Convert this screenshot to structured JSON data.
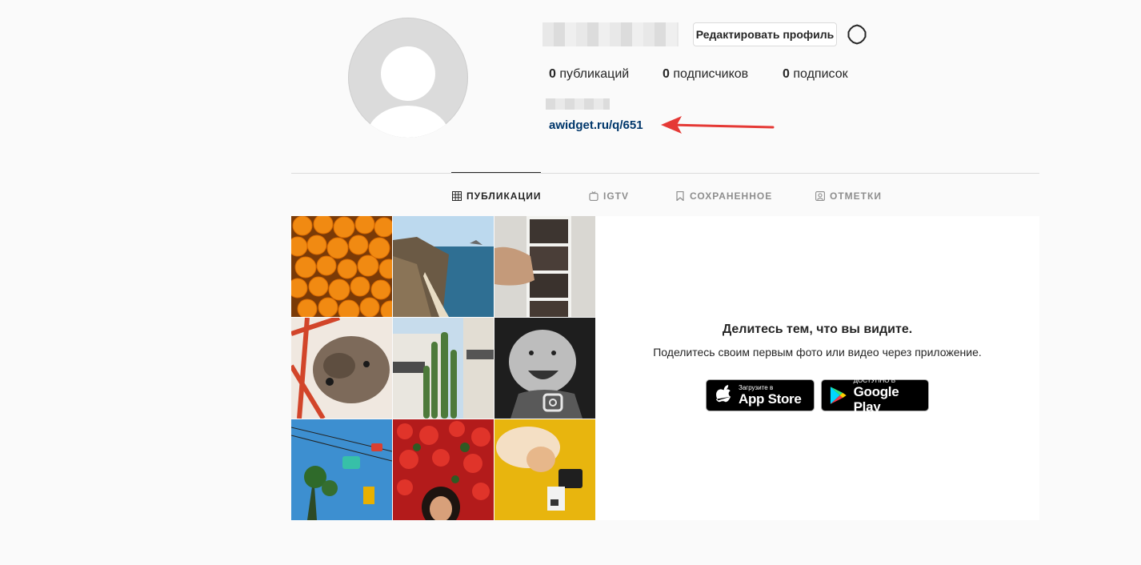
{
  "profile": {
    "edit_button": "Редактировать профиль",
    "stats": [
      {
        "count": "0",
        "label": "публикаций"
      },
      {
        "count": "0",
        "label": "подписчиков"
      },
      {
        "count": "0",
        "label": "подписок"
      }
    ],
    "website": "awidget.ru/q/651"
  },
  "tabs": [
    {
      "label": "ПУБЛИКАЦИИ",
      "icon": "grid-icon",
      "active": true
    },
    {
      "label": "IGTV",
      "icon": "igtv-icon",
      "active": false
    },
    {
      "label": "СОХРАНЕННОЕ",
      "icon": "bookmark-icon",
      "active": false
    },
    {
      "label": "ОТМЕТКИ",
      "icon": "tagged-icon",
      "active": false
    }
  ],
  "promo": {
    "title": "Делитесь тем, что вы видите.",
    "text": "Поделитесь своим первым фото или видео через приложение.",
    "app_store": {
      "small": "Загрузите в",
      "big": "App Store"
    },
    "google_play": {
      "small": "ДОСТУПНО В",
      "big": "Google Play"
    }
  },
  "colors": {
    "background": "#fafafa",
    "link": "#00376b",
    "arrow": "#e53935",
    "border": "#dbdbdb"
  }
}
